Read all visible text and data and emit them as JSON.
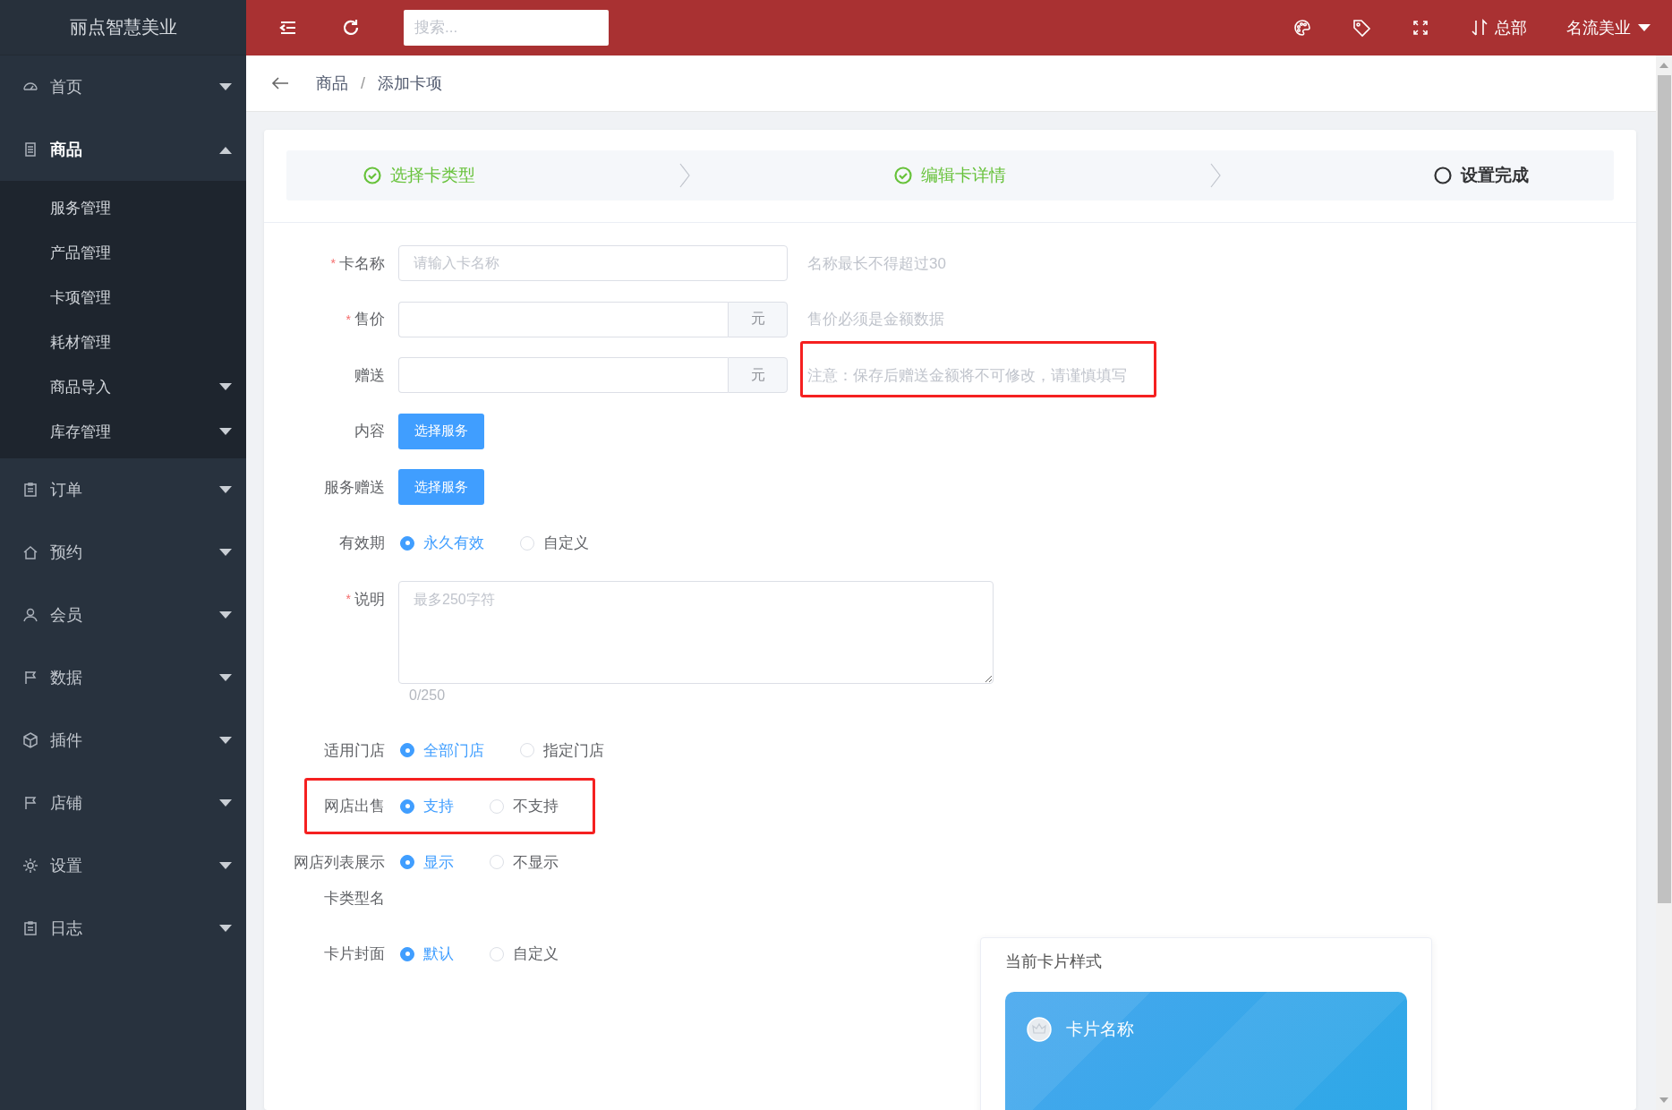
{
  "sidebar": {
    "logo": "丽点智慧美业",
    "items": [
      {
        "label": "首页",
        "selected": false,
        "expanded": false
      },
      {
        "label": "商品",
        "selected": true,
        "expanded": true,
        "children": [
          {
            "label": "服务管理",
            "kind": "link"
          },
          {
            "label": "产品管理",
            "kind": "link"
          },
          {
            "label": "卡项管理",
            "kind": "link"
          },
          {
            "label": "耗材管理",
            "kind": "link"
          },
          {
            "label": "商品导入",
            "kind": "group"
          },
          {
            "label": "库存管理",
            "kind": "group"
          }
        ]
      },
      {
        "label": "订单",
        "selected": false,
        "expanded": false
      },
      {
        "label": "预约",
        "selected": false,
        "expanded": false
      },
      {
        "label": "会员",
        "selected": false,
        "expanded": false
      },
      {
        "label": "数据",
        "selected": false,
        "expanded": false
      },
      {
        "label": "插件",
        "selected": false,
        "expanded": false
      },
      {
        "label": "店铺",
        "selected": false,
        "expanded": false
      },
      {
        "label": "设置",
        "selected": false,
        "expanded": false
      },
      {
        "label": "日志",
        "selected": false,
        "expanded": false
      }
    ]
  },
  "topbar": {
    "search": {
      "placeholder": "搜索..."
    },
    "branch": "总部",
    "user": "名流美业"
  },
  "breadcrumb": {
    "items": [
      "商品",
      "添加卡项"
    ],
    "separator": "/"
  },
  "steps": [
    {
      "label": "选择卡类型",
      "completed": true
    },
    {
      "label": "编辑卡详情",
      "completed": true
    },
    {
      "label": "设置完成",
      "completed": false
    }
  ],
  "form": {
    "rows": [
      {
        "kind": "text",
        "label": "卡名称",
        "required_mark": "*",
        "placeholder": "请输入卡名称",
        "hint": "名称最长不得超过30"
      },
      {
        "kind": "money",
        "label": "售价",
        "required_mark": "*",
        "unit": "元",
        "hint": "售价必须是金额数据"
      },
      {
        "kind": "money",
        "label": "赠送",
        "unit": "元",
        "hint": "注意：保存后赠送金额将不可修改，请谨慎填写",
        "hint_highlighted": true
      },
      {
        "kind": "button",
        "label": "内容",
        "button": "选择服务"
      },
      {
        "kind": "button",
        "label": "服务赠送",
        "button": "选择服务"
      },
      {
        "kind": "radio",
        "label": "有效期",
        "highlighted": false,
        "options": [
          {
            "label": "永久有效",
            "selected": true
          },
          {
            "label": "自定义",
            "selected": false
          }
        ]
      },
      {
        "kind": "textarea",
        "label": "说明",
        "required_mark": "*",
        "placeholder": "最多250字符",
        "counter": "0/250"
      },
      {
        "kind": "radio",
        "label": "适用门店",
        "highlighted": false,
        "options": [
          {
            "label": "全部门店",
            "selected": true
          },
          {
            "label": "指定门店",
            "selected": false
          }
        ]
      },
      {
        "kind": "radio",
        "label": "网店出售",
        "highlighted": true,
        "options": [
          {
            "label": "支持",
            "selected": true
          },
          {
            "label": "不支持",
            "selected": false
          }
        ]
      },
      {
        "kind": "radio",
        "label": "网店列表展示",
        "highlighted": false,
        "options": [
          {
            "label": "显示",
            "selected": true
          },
          {
            "label": "不显示",
            "selected": false
          }
        ]
      },
      {
        "kind": "empty",
        "label": "卡类型名"
      },
      {
        "kind": "cover",
        "label": "卡片封面",
        "options": [
          {
            "label": "默认",
            "selected": true
          },
          {
            "label": "自定义",
            "selected": false
          }
        ]
      }
    ]
  },
  "preview": {
    "title": "当前卡片样式",
    "card_name": "卡片名称"
  }
}
